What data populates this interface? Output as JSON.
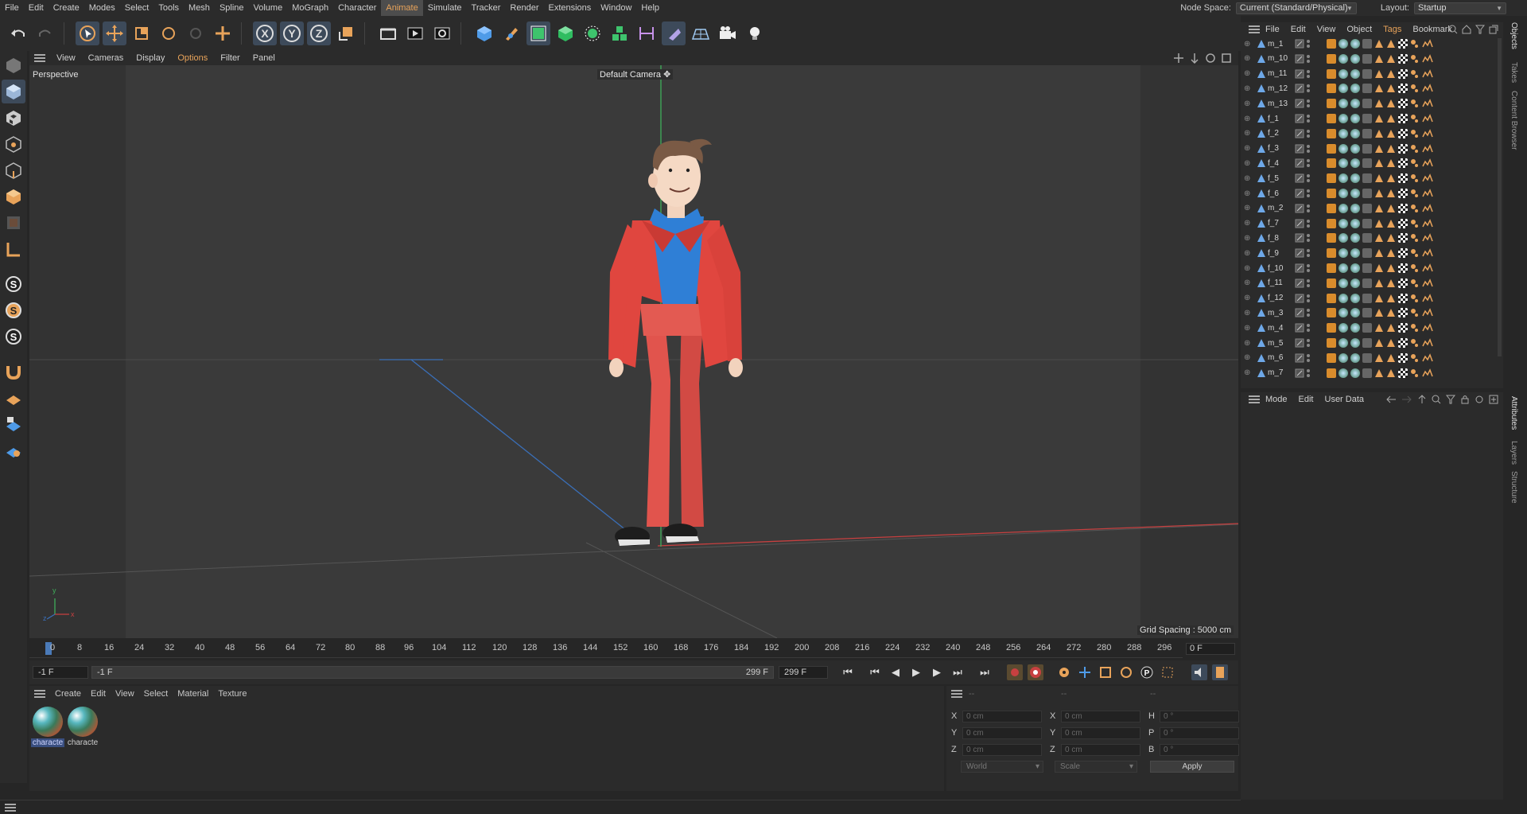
{
  "menubar": {
    "items": [
      "File",
      "Edit",
      "Create",
      "Modes",
      "Select",
      "Tools",
      "Mesh",
      "Spline",
      "Volume",
      "MoGraph",
      "Character",
      "Animate",
      "Simulate",
      "Tracker",
      "Render",
      "Extensions",
      "Window",
      "Help"
    ],
    "active": "Animate",
    "node_space_label": "Node Space:",
    "node_space_value": "Current (Standard/Physical)",
    "layout_label": "Layout:",
    "layout_value": "Startup"
  },
  "viewport": {
    "menu": [
      "View",
      "Cameras",
      "Display",
      "Options",
      "Filter",
      "Panel"
    ],
    "highlighted_menu": "Options",
    "view_name": "Perspective",
    "camera_label": "Default Camera",
    "grid_spacing": "Grid Spacing : 5000 cm",
    "axes": [
      "y",
      "z",
      "x"
    ]
  },
  "timeline": {
    "ticks": [
      "0",
      "8",
      "16",
      "24",
      "32",
      "40",
      "48",
      "56",
      "64",
      "72",
      "80",
      "88",
      "96",
      "104",
      "112",
      "120",
      "128",
      "136",
      "144",
      "152",
      "160",
      "168",
      "176",
      "184",
      "192",
      "200",
      "208",
      "216",
      "224",
      "232",
      "240",
      "248",
      "256",
      "264",
      "272",
      "280",
      "288",
      "296"
    ],
    "current_frame": "0 F"
  },
  "transport": {
    "start_field": "-1 F",
    "range_start": "-1 F",
    "range_end": "299 F",
    "end_field": "299 F"
  },
  "materials": {
    "menu": [
      "Create",
      "Edit",
      "View",
      "Select",
      "Material",
      "Texture"
    ],
    "items": [
      {
        "name": "characte"
      },
      {
        "name": "characte"
      }
    ]
  },
  "coordinates": {
    "headers": [
      "--",
      "--",
      "--"
    ],
    "rows": [
      {
        "a_label": "X",
        "a_value": "0 cm",
        "b_label": "X",
        "b_value": "0 cm",
        "c_label": "H",
        "c_value": "0 °"
      },
      {
        "a_label": "Y",
        "a_value": "0 cm",
        "b_label": "Y",
        "b_value": "0 cm",
        "c_label": "P",
        "c_value": "0 °"
      },
      {
        "a_label": "Z",
        "a_value": "0 cm",
        "b_label": "Z",
        "b_value": "0 cm",
        "c_label": "B",
        "c_value": "0 °"
      }
    ],
    "space": "World",
    "mode": "Scale",
    "apply_label": "Apply"
  },
  "object_manager": {
    "menu": [
      "File",
      "Edit",
      "View",
      "Object",
      "Tags",
      "Bookmark"
    ],
    "highlighted_menu": "Tags",
    "objects": [
      "m_1",
      "m_10",
      "m_11",
      "m_12",
      "m_13",
      "f_1",
      "f_2",
      "f_3",
      "f_4",
      "f_5",
      "f_6",
      "m_2",
      "f_7",
      "f_8",
      "f_9",
      "f_10",
      "f_11",
      "f_12",
      "m_3",
      "m_4",
      "m_5",
      "m_6",
      "m_7"
    ]
  },
  "attributes": {
    "menu": [
      "Mode",
      "Edit",
      "User Data"
    ]
  },
  "side_tabs": {
    "top": [
      "Objects",
      "Takes",
      "Content Browser"
    ],
    "bottom": [
      "Attributes",
      "Layers",
      "Structure"
    ]
  },
  "colors": {
    "accent": "#e8a35a",
    "jacket": "#e0463f",
    "shirt": "#2f7fd6",
    "pants": "#e1544d",
    "x_axis": "#c74040",
    "y_axis": "#3fae5a",
    "z_axis": "#3a6fb8"
  }
}
